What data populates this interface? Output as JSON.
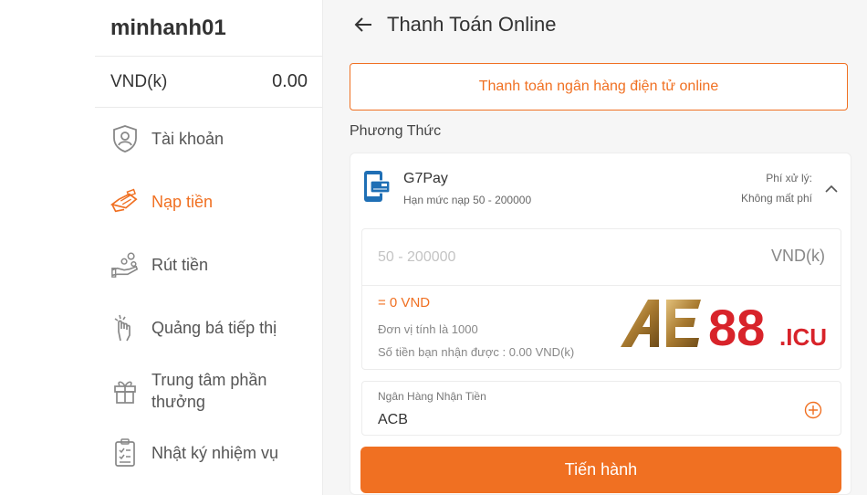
{
  "sidebar": {
    "username": "minhanh01",
    "balance": {
      "currency": "VND(k)",
      "amount": "0.00"
    },
    "items": [
      {
        "label": "Tài khoản",
        "icon": "shield-user-icon",
        "active": false
      },
      {
        "label": "Nạp tiền",
        "icon": "deposit-hand-icon",
        "active": true
      },
      {
        "label": "Rút tiền",
        "icon": "withdraw-hand-icon",
        "active": false
      },
      {
        "label": "Quảng bá tiếp thị",
        "icon": "promo-hand-icon",
        "active": false
      },
      {
        "label": "Trung tâm phần thưởng",
        "icon": "gift-icon",
        "active": false
      },
      {
        "label": "Nhật ký nhiệm vụ",
        "icon": "checklist-icon",
        "active": false
      }
    ]
  },
  "header": {
    "title": "Thanh Toán Online"
  },
  "banner": {
    "label": "Thanh toán ngân hàng điện tử online"
  },
  "method_section_label": "Phương Thức",
  "method": {
    "name": "G7Pay",
    "limit": "Hạn mức nạp 50 - 200000",
    "fee_label": "Phí xử lý:",
    "fee_value": "Không mất phí"
  },
  "amount": {
    "placeholder": "50 - 200000",
    "unit": "VND(k)",
    "converted": "= 0 VND",
    "unit_note": "Đơn vị tính là 1000",
    "receive_note": "Số tiền bạn nhận được : 0.00 VND(k)"
  },
  "bank": {
    "label": "Ngân Hàng Nhận Tiền",
    "value": "ACB"
  },
  "submit_label": "Tiến hành",
  "logo": {
    "text": "AE88",
    "suffix": ".ICU"
  },
  "colors": {
    "accent": "#f07022",
    "logo_red": "#d8232a",
    "logo_gold": "#b8893a"
  }
}
